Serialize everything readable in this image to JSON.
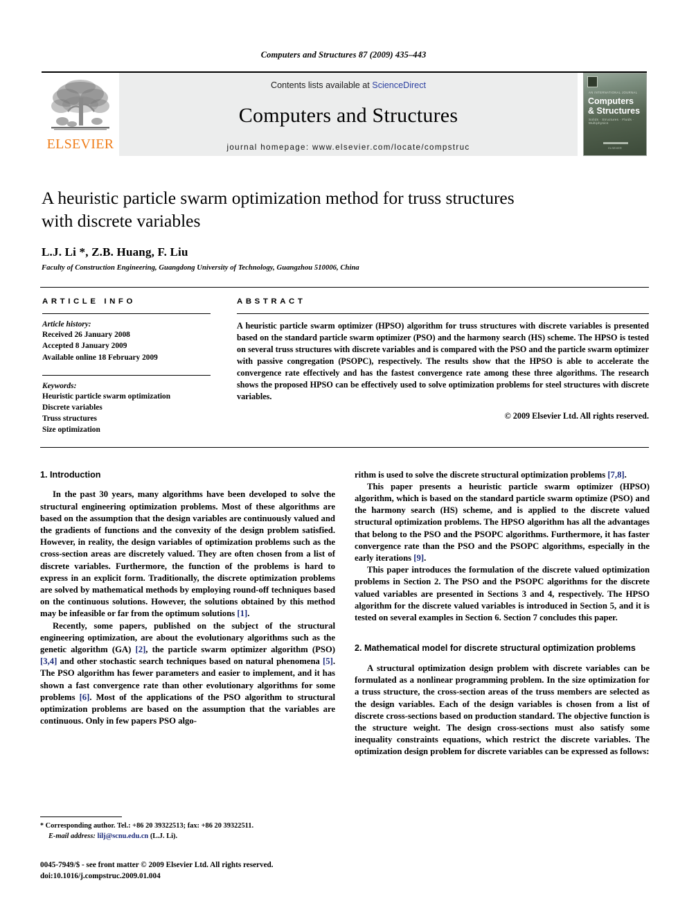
{
  "running_head": "Computers and Structures 87 (2009) 435–443",
  "masthead": {
    "publisher_wordmark": "ELSEVIER",
    "contents_prefix": "Contents lists available at ",
    "contents_link": "ScienceDirect",
    "journal_title": "Computers and Structures",
    "homepage": "journal homepage: www.elsevier.com/locate/compstruc",
    "cover": {
      "kicker": "AN INTERNATIONAL JOURNAL",
      "line1": "Computers",
      "line2": "& Structures",
      "tags": "Solids · Structures · Fluids · Multiphysics",
      "foot": "ELSEVIER"
    }
  },
  "article": {
    "title": "A heuristic particle swarm optimization method for truss structures with discrete variables",
    "authors": "L.J. Li *, Z.B. Huang, F. Liu",
    "author_star": "*",
    "affiliation": "Faculty of Construction Engineering, Guangdong University of Technology, Guangzhou 510006, China"
  },
  "info": {
    "label": "ARTICLE INFO",
    "history_head": "Article history:",
    "history": [
      "Received 26 January 2008",
      "Accepted 8 January 2009",
      "Available online 18 February 2009"
    ],
    "keywords_head": "Keywords:",
    "keywords": [
      "Heuristic particle swarm optimization",
      "Discrete variables",
      "Truss structures",
      "Size optimization"
    ]
  },
  "abstract": {
    "label": "ABSTRACT",
    "text": "A heuristic particle swarm optimizer (HPSO) algorithm for truss structures with discrete variables is presented based on the standard particle swarm optimizer (PSO) and the harmony search (HS) scheme. The HPSO is tested on several truss structures with discrete variables and is compared with the PSO and the particle swarm optimizer with passive congregation (PSOPC), respectively. The results show that the HPSO is able to accelerate the convergence rate effectively and has the fastest convergence rate among these three algorithms. The research shows the proposed HPSO can be effectively used to solve optimization problems for steel structures with discrete variables.",
    "copyright": "© 2009 Elsevier Ltd. All rights reserved."
  },
  "sections": {
    "intro_head": "1. Introduction",
    "intro_p1": "In the past 30 years, many algorithms have been developed to solve the structural engineering optimization problems. Most of these algorithms are based on the assumption that the design variables are continuously valued and the gradients of functions and the convexity of the design problem satisfied. However, in reality, the design variables of optimization problems such as the cross-section areas are discretely valued. They are often chosen from a list of discrete variables. Furthermore, the function of the problems is hard to express in an explicit form. Traditionally, the discrete optimization problems are solved by mathematical methods by employing round-off techniques based on the continuous solutions. However, the solutions obtained by this method may be infeasible or far from the optimum solutions",
    "intro_p1_ref": "[1]",
    "intro_p2_a": "Recently, some papers, published on the subject of the structural engineering optimization, are about the evolutionary algorithms such as the genetic algorithm (GA) ",
    "intro_p2_r1": "[2]",
    "intro_p2_b": ", the particle swarm optimizer algorithm (PSO) ",
    "intro_p2_r2": "[3,4]",
    "intro_p2_c": " and other stochastic search techniques based on natural phenomena ",
    "intro_p2_r3": "[5]",
    "intro_p2_d": ". The PSO algorithm has fewer parameters and easier to implement, and it has shown a fast convergence rate than other evolutionary algorithms for some problems ",
    "intro_p2_r4": "[6]",
    "intro_p2_e": ". Most of the applications of the PSO algorithm to structural optimization problems are based on the assumption that the variables are continuous. Only in few papers PSO algo-",
    "right_p1_a": "rithm is used to solve the discrete structural optimization problems ",
    "right_p1_r": "[7,8]",
    "right_p1_b": ".",
    "right_p2_a": "This paper presents a heuristic particle swarm optimizer (HPSO) algorithm, which is based on the standard particle swarm optimize (PSO) and the harmony search (HS) scheme, and is applied to the discrete valued structural optimization problems. The HPSO algorithm has all the advantages that belong to the PSO and the PSOPC algorithms. Furthermore, it has faster convergence rate than the PSO and the PSOPC algorithms, especially in the early iterations ",
    "right_p2_r": "[9]",
    "right_p2_b": ".",
    "right_p3": "This paper introduces the formulation of the discrete valued optimization problems in Section 2. The PSO and the PSOPC algorithms for the discrete valued variables are presented in Sections 3 and 4, respectively. The HPSO algorithm for the discrete valued variables is introduced in Section 5, and it is tested on several examples in Section 6. Section 7 concludes this paper.",
    "sec2_head": "2. Mathematical model for discrete structural optimization problems",
    "sec2_p1": "A structural optimization design problem with discrete variables can be formulated as a nonlinear programming problem. In the size optimization for a truss structure, the cross-section areas of the truss members are selected as the design variables. Each of the design variables is chosen from a list of discrete cross-sections based on production standard. The objective function is the structure weight. The design cross-sections must also satisfy some inequality constraints equations, which restrict the discrete variables. The optimization design problem for discrete variables can be expressed as follows:"
  },
  "footnote": {
    "star": "*",
    "corresponding": " Corresponding author. Tel.: +86 20 39322513; fax: +86 20 39322511.",
    "email_label": "E-mail address:",
    "email": "lilj@scnu.edu.cn",
    "email_tail": " (L.J. Li)."
  },
  "colophon": {
    "line1": "0045-7949/$ - see front matter © 2009 Elsevier Ltd. All rights reserved.",
    "line2": "doi:10.1016/j.compstruc.2009.01.004"
  },
  "colors": {
    "link_blue": "#2a3ea0",
    "reference_blue": "#1b2a7a",
    "elsevier_orange": "#ef7d19",
    "band_gray": "#eceded"
  }
}
